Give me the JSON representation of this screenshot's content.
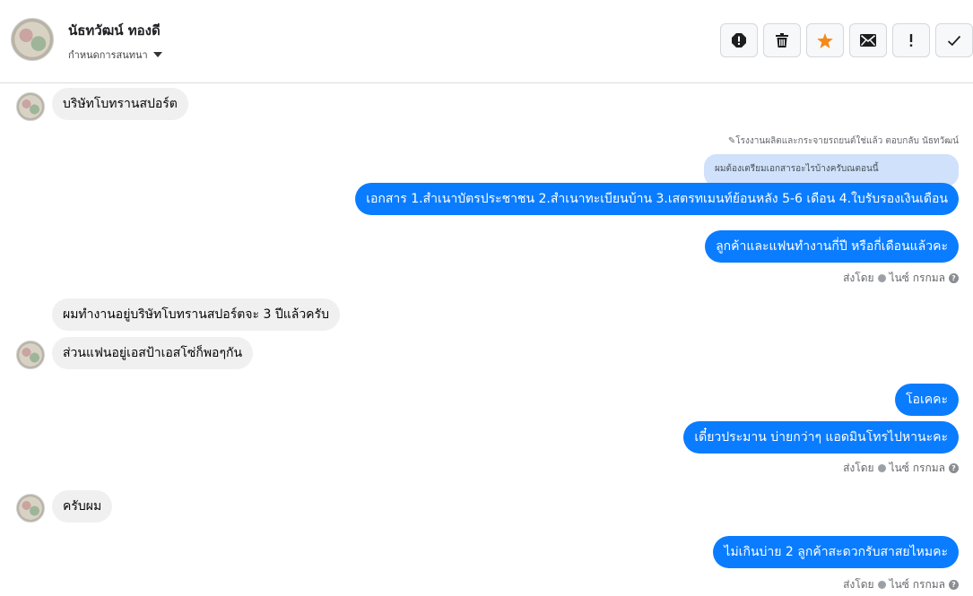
{
  "header": {
    "contact_name": "นัธทวัฒน์ ทองดี",
    "assign_label": "กำหนดการสนทนา",
    "toolbar_icons": [
      "report-icon",
      "trash-icon",
      "star-icon",
      "mail-icon",
      "exclamation-icon",
      "check-icon"
    ],
    "star_color": "#f38a1a"
  },
  "messages": {
    "m1": "บริษัทโบทรานสปอร์ต",
    "reply_note": "✎โรงงานผลิตและกระจายรถยนต์ใช่แล้ว ตอบกลับ นัธทวัฒน์",
    "reply_quote": "ผมต้องเตรียมเอกสารอะไรบ้างครับณตอนนี้",
    "m2": "เอกสาร 1.สำเนาบัตรประชาชน 2.สำเนาทะเบียนบ้าน 3.เสตรทเมนท์ย้อนหลัง 5-6 เดือน 4.ใบรับรองเงินเดือน",
    "m3": "ลูกค้าและแฟนทำงานกี่ปี หรือกี่เดือนแล้วคะ",
    "m4": "ผมทำงานอยู่บริษัทโบทรานสปอร์ตจะ 3 ปีแล้วครับ",
    "m5": "ส่วนแฟนอยู่เอสป้าเอสโซ่ก็พอๆกัน",
    "m6": "โอเคคะ",
    "m7": "เดี๋ยวประมาน บ่ายกว่าๆ แอดมินโทรไปหานะคะ",
    "m8": "ครับผม",
    "m9": "ไม่เกินบ่าย 2 ลูกค้าสะดวกรับสาสยไหมคะ"
  },
  "sent_by": {
    "prefix": "ส่งโดย",
    "agent": "ไนซ์ กรกมล",
    "help_glyph": "?"
  },
  "colors": {
    "outgoing": "#0a7cff",
    "incoming": "#f0f0f0",
    "reply_quote": "#cfe1fb"
  }
}
